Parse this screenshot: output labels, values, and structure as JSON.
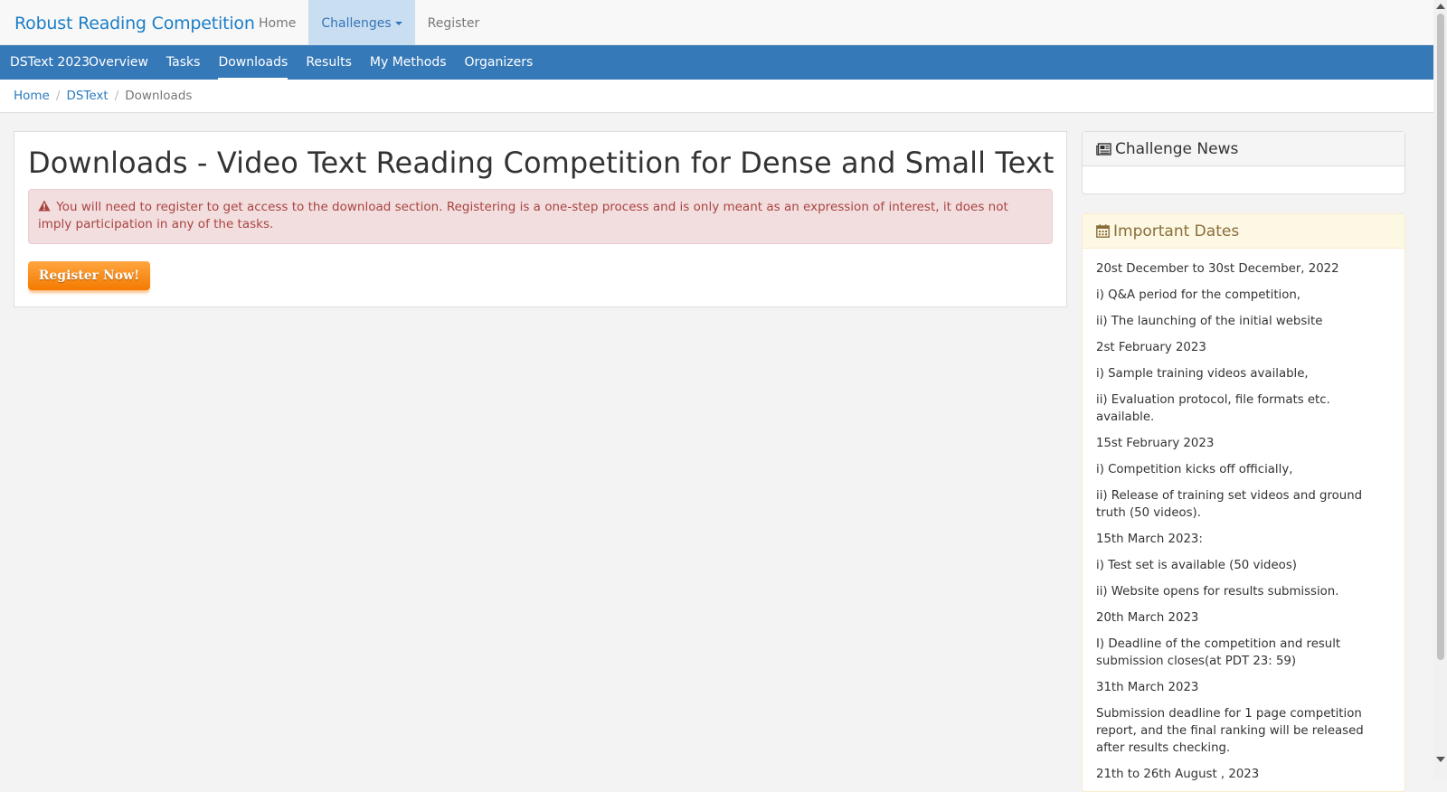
{
  "topbar": {
    "brand": "Robust Reading Competition",
    "nav": [
      {
        "label": "Home"
      },
      {
        "label": "Challenges"
      },
      {
        "label": "Register"
      }
    ]
  },
  "subnav": {
    "title": "DSText 2023",
    "links": [
      {
        "label": "Overview"
      },
      {
        "label": "Tasks"
      },
      {
        "label": "Downloads"
      },
      {
        "label": "Results"
      },
      {
        "label": "My Methods"
      },
      {
        "label": "Organizers"
      }
    ]
  },
  "breadcrumb": {
    "items": [
      "Home",
      "DSText"
    ],
    "current": "Downloads"
  },
  "main": {
    "title": "Downloads - Video Text Reading Competition for Dense and Small Text",
    "alert": "You will need to register to get access to the download section. Registering is a one-step process and is only meant as an expression of interest, it does not imply participation in any of the tasks.",
    "register_button": "Register Now!"
  },
  "sidebar": {
    "news_title": "Challenge News",
    "dates_title": "Important Dates",
    "dates": [
      "20st December to 30st December, 2022",
      "i) Q&A period for the competition,",
      "ii) The launching of the initial website",
      "2st February 2023",
      "i) Sample training videos available,",
      "ii) Evaluation protocol, file formats etc. available.",
      "15st February 2023",
      "i) Competition kicks off officially,",
      "ii) Release of training set videos and ground truth (50 videos).",
      "15th March 2023:",
      "i) Test set is available (50 videos)",
      "ii) Website opens for results submission.",
      "20th March 2023",
      "I) Deadline of the competition and result submission closes(at PDT 23: 59)",
      "31th March 2023",
      "Submission deadline for 1 page competition report, and the final ranking will be released after results checking.",
      "21th to 26th August , 2023"
    ]
  },
  "colors": {
    "brand": "#1b7ec7",
    "subnav_bg": "#3679b8",
    "alert_bg": "#f2dede",
    "alert_text": "#a94442",
    "button_orange": "#f47a00",
    "dates_header_bg": "#fcf8e3"
  },
  "icons": {
    "alert": "warning-triangle-icon",
    "news": "newspaper-icon",
    "dates": "calendar-icon"
  }
}
